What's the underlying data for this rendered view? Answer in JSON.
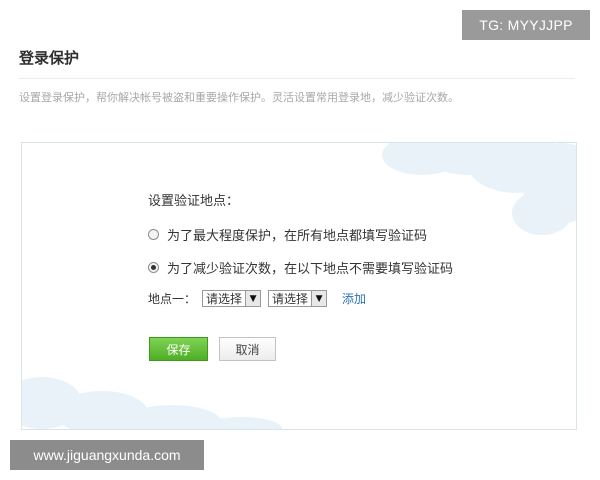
{
  "watermarks": {
    "top": "TG: MYYJJPP",
    "bottom": "www.jiguangxunda.com"
  },
  "page": {
    "title": "登录保护",
    "description": "设置登录保护，帮你解决帐号被盗和重要操作保护。灵活设置常用登录地，减少验证次数。"
  },
  "form": {
    "section_label": "设置验证地点：",
    "options": [
      {
        "label": "为了最大程度保护，在所有地点都填写验证码",
        "selected": false
      },
      {
        "label": "为了减少验证次数，在以下地点不需要填写验证码",
        "selected": true
      }
    ],
    "location": {
      "label": "地点一：",
      "select_1": "请选择",
      "select_2": "请选择",
      "add_link": "添加"
    },
    "buttons": {
      "save": "保存",
      "cancel": "取消"
    }
  },
  "colors": {
    "save_button": "#5bbb2e",
    "link": "#2d73b5",
    "cloud": "#e4eff6"
  },
  "icons": {
    "dropdown": "triangle-down"
  }
}
